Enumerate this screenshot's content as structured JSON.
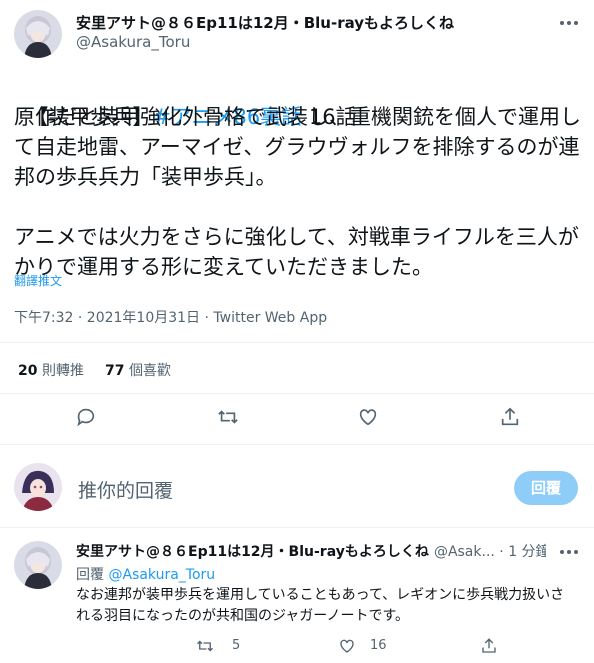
{
  "tweet": {
    "display_name": "安里アサト@８６Ep11は12月・Blu-rayもよろしくね",
    "handle": "@Asakura_Toru",
    "line1_tag": "【装甲歩兵】",
    "line1_hashtag": "#アニメ86裏話",
    "line1_rest": " 16話",
    "body": "原作だと装甲強化外骨格で武装し、重機関銃を個人で運用して自走地雷、アーマイゼ、グラウヴォルフを排除するのが連邦の歩兵兵力「装甲歩兵」。\n\nアニメでは火力をさらに強化して、対戦車ライフルを三人がかりで運用する形に変えていただきました。",
    "translate": "翻譯推文",
    "timestamp": "下午7:32 · 2021年10月31日 · Twitter Web App",
    "retweet_count": "20",
    "retweet_label": "則轉推",
    "like_count": "77",
    "like_label": "個喜歡"
  },
  "compose": {
    "placeholder": "推你的回覆",
    "button": "回覆"
  },
  "reply": {
    "display_name": "安里アサト@８６Ep11は12月・Blu-rayもよろしくね",
    "handle_time": "@Asak... · 1 分鐘",
    "replying_prefix": "回覆",
    "replying_to": "@Asakura_Toru",
    "body": "なお連邦が装甲歩兵を運用していることもあって、レギオンに歩兵戦力扱いされる羽目になったのが共和国のジャガーノートです。",
    "retweets": "5",
    "likes": "16"
  },
  "colors": {
    "accent": "#1d9bf0",
    "muted": "#536471",
    "button_disabled": "#8ecdf8"
  }
}
